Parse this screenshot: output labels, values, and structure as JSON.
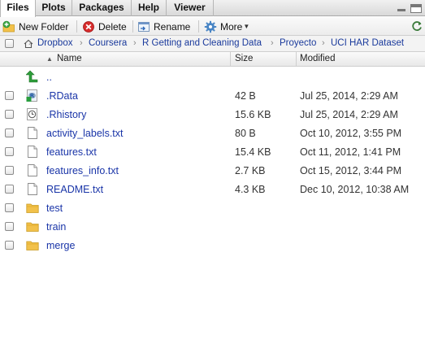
{
  "tabs": [
    {
      "label": "Files",
      "active": true
    },
    {
      "label": "Plots",
      "active": false
    },
    {
      "label": "Packages",
      "active": false
    },
    {
      "label": "Help",
      "active": false
    },
    {
      "label": "Viewer",
      "active": false
    }
  ],
  "toolbar": {
    "new_folder": "New Folder",
    "delete": "Delete",
    "rename": "Rename",
    "more": "More"
  },
  "breadcrumb": [
    "Dropbox",
    "Coursera",
    "R Getting and Cleaning Data",
    "Proyecto",
    "UCI HAR Dataset"
  ],
  "columns": {
    "name": "Name",
    "size": "Size",
    "modified": "Modified"
  },
  "parent_label": "..",
  "files": [
    {
      "name": ".RData",
      "size": "42 B",
      "modified": "Jul 25, 2014, 2:29 AM",
      "icon": "rdata-icon"
    },
    {
      "name": ".Rhistory",
      "size": "15.6 KB",
      "modified": "Jul 25, 2014, 2:29 AM",
      "icon": "history-icon"
    },
    {
      "name": "activity_labels.txt",
      "size": "80 B",
      "modified": "Oct 10, 2012, 3:55 PM",
      "icon": "text-file-icon"
    },
    {
      "name": "features.txt",
      "size": "15.4 KB",
      "modified": "Oct 11, 2012, 1:41 PM",
      "icon": "text-file-icon"
    },
    {
      "name": "features_info.txt",
      "size": "2.7 KB",
      "modified": "Oct 15, 2012, 3:44 PM",
      "icon": "text-file-icon"
    },
    {
      "name": "README.txt",
      "size": "4.3 KB",
      "modified": "Dec 10, 2012, 10:38 AM",
      "icon": "text-file-icon"
    },
    {
      "name": "test",
      "size": "",
      "modified": "",
      "icon": "folder-icon"
    },
    {
      "name": "train",
      "size": "",
      "modified": "",
      "icon": "folder-icon"
    },
    {
      "name": "merge",
      "size": "",
      "modified": "",
      "icon": "folder-icon"
    }
  ],
  "colors": {
    "link": "#1a35a8",
    "folder": "#f2c14a",
    "up_arrow": "#2e9e3a"
  }
}
